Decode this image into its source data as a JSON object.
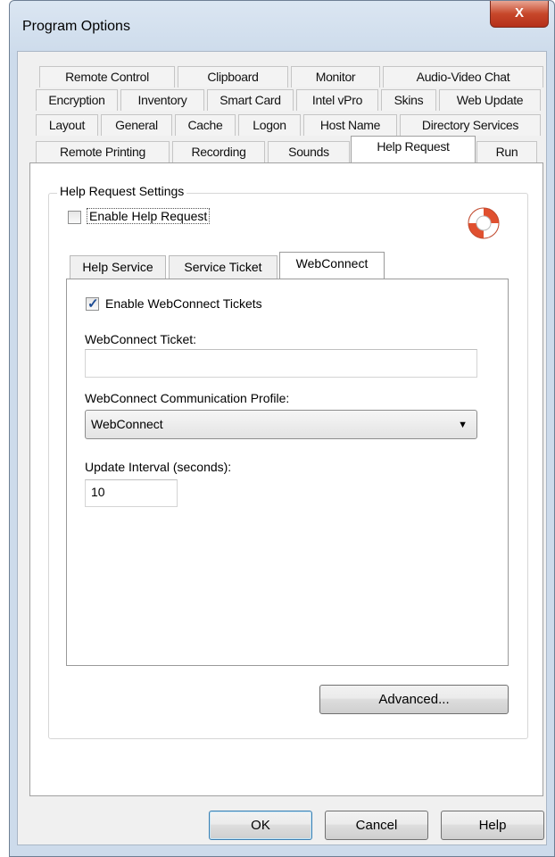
{
  "window": {
    "title": "Program Options",
    "close_label": "X"
  },
  "tabs": {
    "row1": [
      "Remote Control",
      "Clipboard",
      "Monitor",
      "Audio-Video Chat"
    ],
    "row2": [
      "Encryption",
      "Inventory",
      "Smart Card",
      "Intel vPro",
      "Skins",
      "Web Update"
    ],
    "row3": [
      "Layout",
      "General",
      "Cache",
      "Logon",
      "Host Name",
      "Directory Services"
    ],
    "row4": [
      "Remote Printing",
      "Recording",
      "Sounds",
      "Help Request",
      "Run"
    ],
    "active": "Help Request"
  },
  "help_request": {
    "group_label": "Help Request Settings",
    "enable_label": "Enable Help Request",
    "enable_checked": false,
    "inner_tabs": [
      "Help Service",
      "Service Ticket",
      "WebConnect"
    ],
    "active_inner_tab": "WebConnect",
    "webconnect": {
      "enable_tickets_label": "Enable WebConnect Tickets",
      "enable_tickets_checked": true,
      "ticket_label": "WebConnect Ticket:",
      "ticket_value": "",
      "profile_label": "WebConnect Communication Profile:",
      "profile_value": "WebConnect",
      "interval_label": "Update Interval (seconds):",
      "interval_value": "10"
    },
    "advanced_label": "Advanced..."
  },
  "buttons": {
    "ok": "OK",
    "cancel": "Cancel",
    "help": "Help"
  },
  "icons": {
    "lifebuoy": "lifebuoy-icon",
    "dropdown": "chevron-down-icon"
  },
  "colors": {
    "title_bar": "#cddbeb",
    "close_button": "#c7472a",
    "checkbox_check": "#1d4c94"
  }
}
